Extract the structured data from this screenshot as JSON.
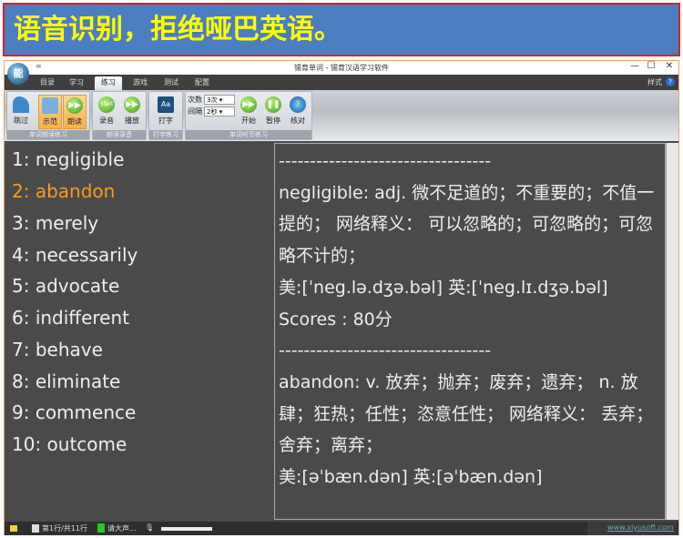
{
  "banner": "语音识别，拒绝哑巴英语。",
  "window": {
    "title": "锡育单词 - 锡育汉语学习软件",
    "quick_access": "=",
    "minimize": "—",
    "maximize": "☐",
    "close": "✕",
    "logo": "能"
  },
  "tabs": [
    "目录",
    "学习",
    "练习",
    "游戏",
    "测试",
    "配置"
  ],
  "active_tab": 2,
  "style_label": "样式",
  "help": "?",
  "ribbon": {
    "groups": [
      "单词朗读练习",
      "朗读录音",
      "打字练习",
      "单词听写练习"
    ],
    "buttons": {
      "skip": "跳过",
      "demo": "示范",
      "read": "朗读",
      "record": "录音",
      "play": "播放",
      "type": "打字",
      "start": "开始",
      "pause": "暂停",
      "check": "核对"
    },
    "times_label": "次数",
    "times_value": "3次",
    "interval_label": "间隔",
    "interval_value": "2秒"
  },
  "words": [
    "1: negligible",
    "2: abandon",
    "3: merely",
    "4: necessarily",
    "5: advocate",
    "6: indifferent",
    "7: behave",
    "8: eliminate",
    "9: commence",
    "10: outcome"
  ],
  "highlight_color": "#ff9a1a",
  "detail": [
    "----------------------------------",
    "negligible: adj. 微不足道的；不重要的；不值一提的；  网络释义：  可以忽略的；可忽略的；可忽略不计的；",
    "美:[ˈneg.lə.dʒə.bəl]    英:[ˈneg.lɪ.dʒə.bəl]",
    "Scores : 80分",
    "----------------------------------",
    "abandon: v. 放弃；抛弃；废弃；遗弃；  n. 放肆；狂热；任性；恣意任性；  网络释义：  丢弃；舍弃；离弃；",
    "美:[əˈbæn.dən]    英:[əˈbæn.dən]"
  ],
  "status": {
    "row": "第1行/共11行",
    "prompt": "请大声...",
    "site": "www.xiyusoft.com"
  }
}
